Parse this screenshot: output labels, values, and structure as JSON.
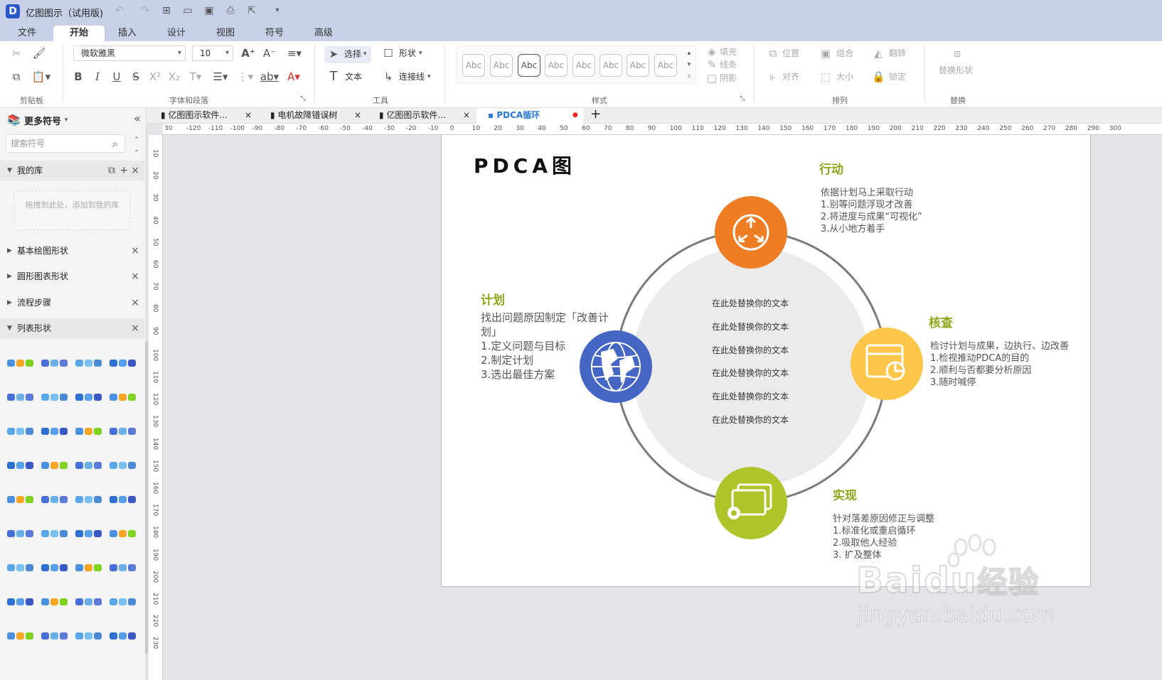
{
  "app": {
    "title": "亿图图示（试用版)",
    "logo_glyph": "D"
  },
  "menu_tabs": [
    "文件",
    "开始",
    "插入",
    "设计",
    "视图",
    "符号",
    "高级"
  ],
  "ribbon": {
    "font_name": "微软雅黑",
    "font_size": "10",
    "select_label": "选择",
    "shape_label": "形状",
    "text_label": "文本",
    "connector_label": "连接线",
    "style_sample": "Abc",
    "fill_label": "填充",
    "line_label": "线条",
    "shadow_label": "阴影",
    "position_label": "位置",
    "group_label": "组合",
    "flip_label": "翻转",
    "align_label": "对齐",
    "size_label": "大小",
    "lock_label": "锁定",
    "replace_shape_label": "替换形状",
    "groups": {
      "clipboard": "剪贴板",
      "font": "字体和段落",
      "tools": "工具",
      "style": "样式",
      "arrange": "排列",
      "replace": "替换"
    }
  },
  "left_panel": {
    "title": "更多符号",
    "search_placeholder": "搜索符号",
    "my_library": "我的库",
    "drop_hint": "拖拽到此处，添加到我的库",
    "sections": [
      "基本绘图形状",
      "圆形图表形状",
      "流程步骤",
      "列表形状"
    ]
  },
  "doc_tabs": [
    "亿图图示软件...",
    "电机故障错误树",
    "亿图图示软件...",
    "PDCA循环"
  ],
  "ruler": {
    "h_labels": [
      "30",
      "-120",
      "-110",
      "-100",
      "-90",
      "-80",
      "-70",
      "-60",
      "-50",
      "-40",
      "-30",
      "-20",
      "-10",
      "0",
      "10",
      "20",
      "30",
      "40",
      "50",
      "60",
      "70",
      "80",
      "90",
      "100",
      "110",
      "120",
      "130",
      "140",
      "150",
      "160",
      "170",
      "180",
      "190",
      "200",
      "210",
      "220",
      "230",
      "240",
      "250",
      "260",
      "270",
      "280",
      "290",
      "300"
    ],
    "v_labels": [
      "10",
      "20",
      "30",
      "40",
      "50",
      "60",
      "70",
      "80",
      "90",
      "100",
      "110",
      "120",
      "130",
      "140",
      "150",
      "160",
      "170",
      "180",
      "190",
      "200",
      "210",
      "220",
      "230"
    ]
  },
  "diagram": {
    "title": "PDCA图",
    "act": {
      "heading": "行动",
      "text": "依据计划马上采取行动\n1.别等问题浮现才改善\n2.将进度与成果“可视化”\n3.从小地方着手",
      "color": "#ee7d24"
    },
    "plan": {
      "heading": "计划",
      "text": "找出问题原因制定「改善计\n划」\n1.定义问题与目标\n2.制定计划\n3.选出最佳方案",
      "color": "#4566c4"
    },
    "check": {
      "heading": "核查",
      "text": "检讨计划与成果，边执行、边改善\n1.检视推动PDCA的目的\n2.顺利与否都要分析原因\n3.随时喊停",
      "color": "#fbc64a"
    },
    "do": {
      "heading": "实现",
      "text": "针对落差原因修正与调整\n1.标准化或重启循环\n2.吸取他人经验\n3. 扩及整体",
      "color": "#afc32a"
    },
    "heading_color": "#8fa61c",
    "center_lines": [
      "在此处替换你的文本",
      "在此处替换你的文本",
      "在此处替换你的文本",
      "在此处替换你的文本",
      "在此处替换你的文本",
      "在此处替换你的文本"
    ]
  },
  "watermark": {
    "brand": "Bai",
    "brand2": "经验",
    "url": "jingyan.baidu.com"
  }
}
